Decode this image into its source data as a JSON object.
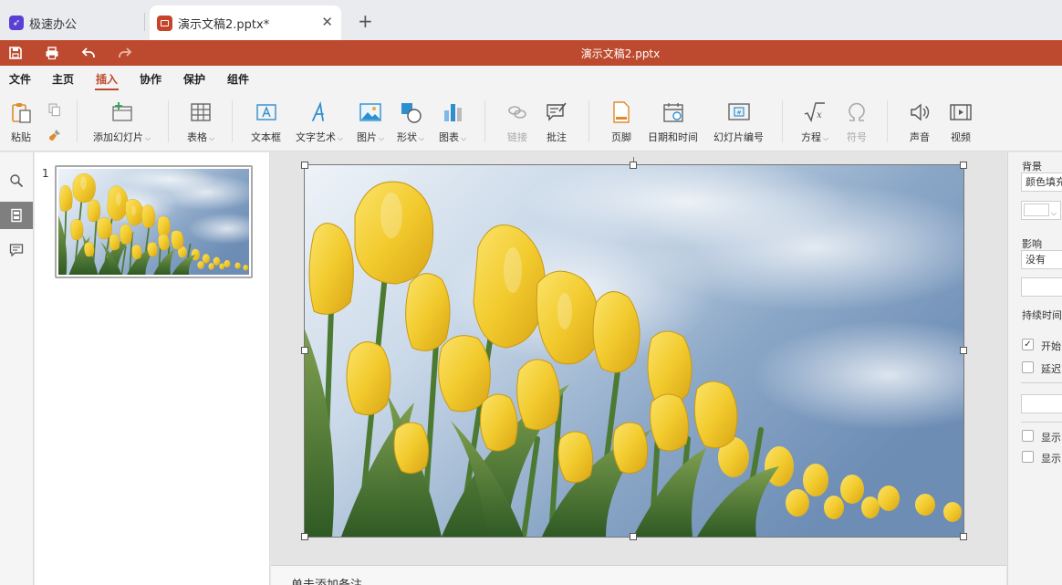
{
  "browser": {
    "tabs": [
      {
        "label": "极速办公"
      },
      {
        "label": "演示文稿2.pptx*",
        "close": "✕"
      }
    ],
    "add_tab": "+"
  },
  "titlebar": {
    "title": "演示文稿2.pptx",
    "background_color": "#bd4a2e"
  },
  "menu": {
    "items": [
      "文件",
      "主页",
      "插入",
      "协作",
      "保护",
      "组件"
    ],
    "active": "插入"
  },
  "ribbon": {
    "paste": "粘贴",
    "add_slide": "添加幻灯片",
    "table": "表格",
    "textbox": "文本框",
    "text_art": "文字艺术",
    "image": "图片",
    "shape": "形状",
    "chart": "图表",
    "link": "链接",
    "comment": "批注",
    "footer": "页脚",
    "datetime": "日期和时间",
    "slide_number": "幻灯片编号",
    "equation": "方程",
    "symbol": "符号",
    "audio": "声音",
    "video": "视频"
  },
  "thumbnails": {
    "slides": [
      {
        "number": "1"
      }
    ]
  },
  "notes": {
    "placeholder": "单击添加备注"
  },
  "properties": {
    "background_label": "背景",
    "fill_value": "颜色填充",
    "effect_label": "影响",
    "effect_value": "没有",
    "duration_label": "持续时间",
    "start_on_click": {
      "label": "开始",
      "checked": true
    },
    "delay": {
      "label": "延迟",
      "checked": false
    },
    "show1": {
      "label": "显示",
      "checked": false
    },
    "show2": {
      "label": "显示",
      "checked": false
    }
  }
}
